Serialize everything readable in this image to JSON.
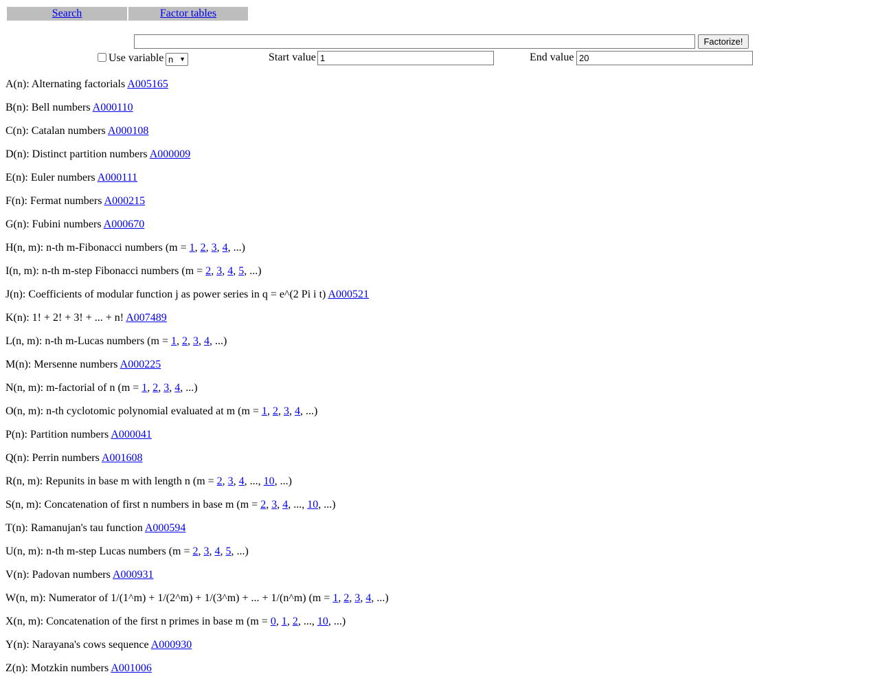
{
  "nav": {
    "search": "Search",
    "factor_tables": "Factor tables"
  },
  "form": {
    "expression_value": "",
    "factorize_button": "Factorize!",
    "use_variable_label": "Use variable",
    "use_variable_checked": false,
    "variable_selected": "n",
    "start_label": "Start value",
    "start_value": "1",
    "end_label": "End value",
    "end_value": "20"
  },
  "functions": [
    {
      "parts": [
        {
          "t": "A(n): Alternating factorials "
        },
        {
          "l": "A005165"
        }
      ]
    },
    {
      "parts": [
        {
          "t": "B(n): Bell numbers "
        },
        {
          "l": "A000110"
        }
      ]
    },
    {
      "parts": [
        {
          "t": "C(n): Catalan numbers "
        },
        {
          "l": "A000108"
        }
      ]
    },
    {
      "parts": [
        {
          "t": "D(n): Distinct partition numbers "
        },
        {
          "l": "A000009"
        }
      ]
    },
    {
      "parts": [
        {
          "t": "E(n): Euler numbers "
        },
        {
          "l": "A000111"
        }
      ]
    },
    {
      "parts": [
        {
          "t": "F(n): Fermat numbers "
        },
        {
          "l": "A000215"
        }
      ]
    },
    {
      "parts": [
        {
          "t": "G(n): Fubini numbers "
        },
        {
          "l": "A000670"
        }
      ]
    },
    {
      "parts": [
        {
          "t": "H(n, m): n-th m-Fibonacci numbers (m = "
        },
        {
          "l": "1"
        },
        {
          "t": ", "
        },
        {
          "l": "2"
        },
        {
          "t": ", "
        },
        {
          "l": "3"
        },
        {
          "t": ", "
        },
        {
          "l": "4"
        },
        {
          "t": ", ...)"
        }
      ]
    },
    {
      "parts": [
        {
          "t": "I(n, m): n-th m-step Fibonacci numbers (m = "
        },
        {
          "l": "2"
        },
        {
          "t": ", "
        },
        {
          "l": "3"
        },
        {
          "t": ", "
        },
        {
          "l": "4"
        },
        {
          "t": ", "
        },
        {
          "l": "5"
        },
        {
          "t": ", ...)"
        }
      ]
    },
    {
      "parts": [
        {
          "t": "J(n): Coefficients of modular function j as power series in q = e^(2 Pi i t) "
        },
        {
          "l": "A000521"
        }
      ]
    },
    {
      "parts": [
        {
          "t": "K(n): 1! + 2! + 3! + ... + n! "
        },
        {
          "l": "A007489"
        }
      ]
    },
    {
      "parts": [
        {
          "t": "L(n, m): n-th m-Lucas numbers (m = "
        },
        {
          "l": "1"
        },
        {
          "t": ", "
        },
        {
          "l": "2"
        },
        {
          "t": ", "
        },
        {
          "l": "3"
        },
        {
          "t": ", "
        },
        {
          "l": "4"
        },
        {
          "t": ", ...)"
        }
      ]
    },
    {
      "parts": [
        {
          "t": "M(n): Mersenne numbers "
        },
        {
          "l": "A000225"
        }
      ]
    },
    {
      "parts": [
        {
          "t": "N(n, m): m-factorial of n (m = "
        },
        {
          "l": "1"
        },
        {
          "t": ", "
        },
        {
          "l": "2"
        },
        {
          "t": ", "
        },
        {
          "l": "3"
        },
        {
          "t": ", "
        },
        {
          "l": "4"
        },
        {
          "t": ", ...)"
        }
      ]
    },
    {
      "parts": [
        {
          "t": "O(n, m): n-th cyclotomic polynomial evaluated at m (m = "
        },
        {
          "l": "1"
        },
        {
          "t": ", "
        },
        {
          "l": "2"
        },
        {
          "t": ", "
        },
        {
          "l": "3"
        },
        {
          "t": ", "
        },
        {
          "l": "4"
        },
        {
          "t": ", ...)"
        }
      ]
    },
    {
      "parts": [
        {
          "t": "P(n): Partition numbers "
        },
        {
          "l": "A000041"
        }
      ]
    },
    {
      "parts": [
        {
          "t": "Q(n): Perrin numbers "
        },
        {
          "l": "A001608"
        }
      ]
    },
    {
      "parts": [
        {
          "t": "R(n, m): Repunits in base m with length n (m = "
        },
        {
          "l": "2"
        },
        {
          "t": ", "
        },
        {
          "l": "3"
        },
        {
          "t": ", "
        },
        {
          "l": "4"
        },
        {
          "t": ", ..., "
        },
        {
          "l": "10"
        },
        {
          "t": ", ...)"
        }
      ]
    },
    {
      "parts": [
        {
          "t": "S(n, m): Concatenation of first n numbers in base m (m = "
        },
        {
          "l": "2"
        },
        {
          "t": ", "
        },
        {
          "l": "3"
        },
        {
          "t": ", "
        },
        {
          "l": "4"
        },
        {
          "t": ", ..., "
        },
        {
          "l": "10"
        },
        {
          "t": ", ...)"
        }
      ]
    },
    {
      "parts": [
        {
          "t": "T(n): Ramanujan's tau function "
        },
        {
          "l": "A000594"
        }
      ]
    },
    {
      "parts": [
        {
          "t": "U(n, m): n-th m-step Lucas numbers (m = "
        },
        {
          "l": "2"
        },
        {
          "t": ", "
        },
        {
          "l": "3"
        },
        {
          "t": ", "
        },
        {
          "l": "4"
        },
        {
          "t": ", "
        },
        {
          "l": "5"
        },
        {
          "t": ", ...)"
        }
      ]
    },
    {
      "parts": [
        {
          "t": "V(n): Padovan numbers "
        },
        {
          "l": "A000931"
        }
      ]
    },
    {
      "parts": [
        {
          "t": "W(n, m): Numerator of 1/(1^m) + 1/(2^m) + 1/(3^m) + ... + 1/(n^m) (m = "
        },
        {
          "l": "1"
        },
        {
          "t": ", "
        },
        {
          "l": "2"
        },
        {
          "t": ", "
        },
        {
          "l": "3"
        },
        {
          "t": ", "
        },
        {
          "l": "4"
        },
        {
          "t": ", ...)"
        }
      ]
    },
    {
      "parts": [
        {
          "t": "X(n, m): Concatenation of the first n primes in base m (m = "
        },
        {
          "l": "0"
        },
        {
          "t": ", "
        },
        {
          "l": "1"
        },
        {
          "t": ", "
        },
        {
          "l": "2"
        },
        {
          "t": ", ..., "
        },
        {
          "l": "10"
        },
        {
          "t": ", ...)"
        }
      ]
    },
    {
      "parts": [
        {
          "t": "Y(n): Narayana's cows sequence "
        },
        {
          "l": "A000930"
        }
      ]
    },
    {
      "parts": [
        {
          "t": "Z(n): Motzkin numbers "
        },
        {
          "l": "A001006"
        }
      ]
    }
  ]
}
